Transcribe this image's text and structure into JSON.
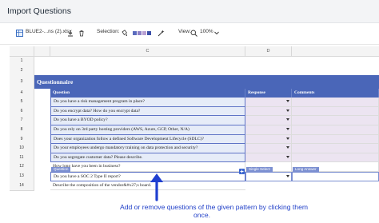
{
  "window": {
    "title": "Import Questions"
  },
  "toolbar": {
    "file_name": "BLUE2-...ns (2).xlsx",
    "selection_label": "Selection:",
    "view_label": "View:",
    "zoom": "100%",
    "swatch_colors": [
      "#5a6bbd",
      "#8c7fc6",
      "#b89fd2",
      "#3b4fa8"
    ]
  },
  "sheet": {
    "col_headers": [
      "",
      "C",
      "D",
      ""
    ],
    "rows": [
      {
        "num": "1"
      },
      {
        "num": "2"
      },
      {
        "num": "3",
        "banner": "Questionnaire"
      },
      {
        "num": "4",
        "headers": [
          "Question",
          "Response",
          "Comments"
        ]
      },
      {
        "num": "5",
        "question": "Do you have a risk management program in place?"
      },
      {
        "num": "6",
        "question": "Do you encrypt data? How do you encrypt data?"
      },
      {
        "num": "7",
        "question": "Do you have a BYOD policy?"
      },
      {
        "num": "8",
        "question": "Do you rely on 3rd party hosting providers (AWS, Azure, GCP, Other, N/A)"
      },
      {
        "num": "9",
        "question": "Does your organization follow a defined Software Development Lifecycle (SDLC)?"
      },
      {
        "num": "10",
        "question": "Do your employees undergo mandatory training on data protection and security?"
      },
      {
        "num": "11",
        "question": "Do you segregate customer data? Please describe."
      },
      {
        "num": "12",
        "question": "How long have you been in business?",
        "tags": [
          "Question",
          "Single Select",
          "Long Answer"
        ]
      },
      {
        "num": "13",
        "question": "Do you have a SOC 2 Type II report?"
      },
      {
        "num": "14",
        "question": "Describe the composition of the vendor&#x27;s board."
      }
    ]
  },
  "caption": {
    "text_line1": "Add or remove questions of the given pattern by clicking them",
    "text_line2": "once."
  }
}
